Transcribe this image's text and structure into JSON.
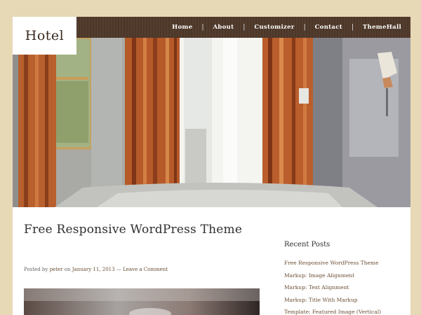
{
  "site": {
    "title": "Hotel"
  },
  "nav": {
    "items": [
      "Home",
      "About",
      "Customizer",
      "Contact",
      "ThemeHall"
    ]
  },
  "post": {
    "title": "Free Responsive WordPress Theme",
    "meta": {
      "posted_by_label": "Posted by",
      "author": "peter",
      "on_label": "on",
      "date": "January 11, 2013",
      "separator": "—",
      "comment_link": "Leave a Comment"
    }
  },
  "sidebar": {
    "widget_title": "Recent Posts",
    "recent_posts": [
      "Free Responsive WordPress Theme",
      "Markup: Image Alignment",
      "Markup: Text Alignment",
      "Markup: Title With Markup",
      "Template: Featured Image (Vertical)"
    ]
  },
  "colors": {
    "background": "#e7d8b6",
    "navbar": "#4e3829",
    "link": "#6b4f35",
    "curtain": "#b85a2a"
  }
}
